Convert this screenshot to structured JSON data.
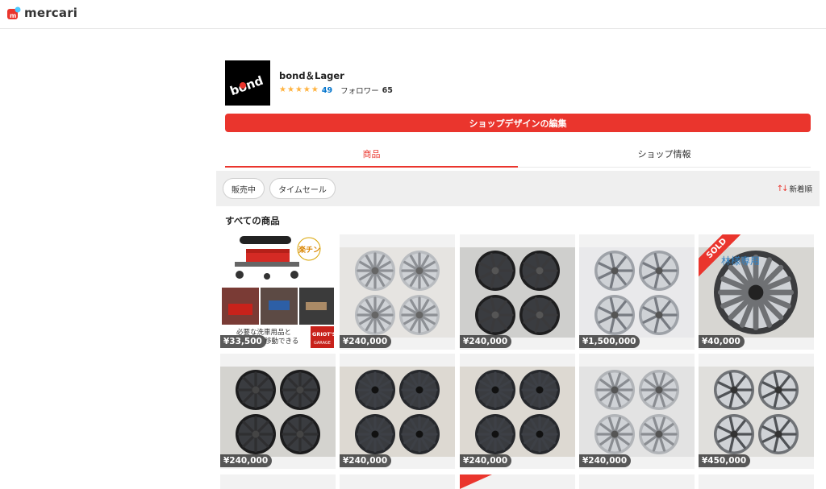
{
  "header": {
    "logo_text": "mercari",
    "brand_color": "#ea352d"
  },
  "shop": {
    "avatar_text": "bond",
    "name": "bond＆Lager",
    "rating_stars": 5,
    "rating_count": "49",
    "followers_label": "フォロワー",
    "followers_count": "65",
    "edit_button_label": "ショップデザインの編集"
  },
  "tabs": [
    {
      "label": "商品",
      "active": true
    },
    {
      "label": "ショップ情報",
      "active": false
    }
  ],
  "filters": {
    "chips": [
      "販売中",
      "タイムセール"
    ],
    "sort_label": "新着順"
  },
  "section_title": "すべての商品",
  "promo_card": {
    "badge_text": "楽チン",
    "caption_line1": "必要な洗車用品と",
    "caption_line2": "移動できる",
    "brand_label": "GRIOT'S",
    "brand_sub": "GARAGE"
  },
  "products": [
    {
      "price": "¥33,500",
      "sold": false,
      "kind": "promo"
    },
    {
      "price": "¥240,000",
      "sold": false,
      "kind": "silver-mesh"
    },
    {
      "price": "¥240,000",
      "sold": false,
      "kind": "black-spoke"
    },
    {
      "price": "¥1,500,000",
      "sold": false,
      "kind": "silver-spoke"
    },
    {
      "price": "¥40,000",
      "sold": true,
      "sold_label": "SOLD",
      "overlay_text": "林様専用",
      "kind": "single-wheel"
    },
    {
      "price": "¥240,000",
      "sold": false,
      "kind": "black-steel"
    },
    {
      "price": "¥240,000",
      "sold": false,
      "kind": "black-mesh"
    },
    {
      "price": "¥240,000",
      "sold": false,
      "kind": "black-mesh"
    },
    {
      "price": "¥240,000",
      "sold": false,
      "kind": "silver-10spoke"
    },
    {
      "price": "¥450,000",
      "sold": false,
      "kind": "gunmetal-spoke"
    }
  ]
}
